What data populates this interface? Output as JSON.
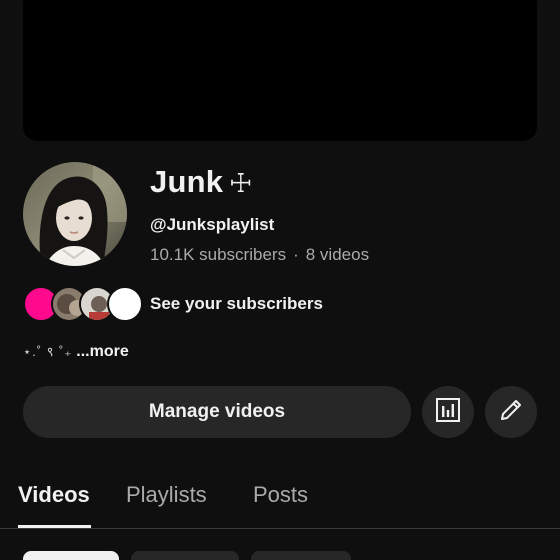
{
  "channel": {
    "name": "Junk",
    "name_symbol": "☩",
    "handle": "@Junksplaylist",
    "subscribers": "10.1K subscribers",
    "separator": "·",
    "videos": "8 videos"
  },
  "subscribers_row": {
    "label": "See your subscribers"
  },
  "description": {
    "text": "⋆.˚ ९ ˚₊",
    "more_label": "...more"
  },
  "actions": {
    "manage_label": "Manage videos",
    "analytics_icon": "analytics-icon",
    "edit_icon": "pencil-icon"
  },
  "tabs": [
    {
      "label": "Videos",
      "active": true
    },
    {
      "label": "Playlists",
      "active": false
    },
    {
      "label": "Posts",
      "active": false
    }
  ],
  "colors": {
    "background": "#0f0f0f",
    "button": "#272727",
    "accent_pink": "#ff0a8c",
    "secondary_text": "#aaaaaa"
  }
}
